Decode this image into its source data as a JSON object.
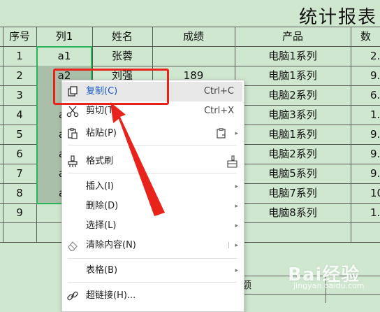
{
  "sheet": {
    "title": "统计报表",
    "headers": [
      "序号",
      "列1",
      "姓名",
      "成绩",
      "产品",
      "数"
    ],
    "rows": [
      {
        "num": "1",
        "col1": "a1",
        "name": "张蓉",
        "score": "",
        "product": "电脑1系列",
        "qty": "2."
      },
      {
        "num": "2",
        "col1": "a2",
        "name": "刘强",
        "score": "189",
        "product": "电脑1系列",
        "qty": "9."
      },
      {
        "num": "3",
        "col1": "",
        "name": "",
        "score": "",
        "product": "电脑2系列",
        "qty": "6."
      },
      {
        "num": "4",
        "col1": "a",
        "name": "",
        "score": "",
        "product": "电脑3系列",
        "qty": "1."
      },
      {
        "num": "5",
        "col1": "a",
        "name": "",
        "score": "",
        "product": "电脑1系列",
        "qty": "9."
      },
      {
        "num": "6",
        "col1": "a",
        "name": "",
        "score": "",
        "product": "电脑2系列",
        "qty": "9."
      },
      {
        "num": "7",
        "col1": "a",
        "name": "",
        "score": "",
        "product": "电脑5系列",
        "qty": "9."
      },
      {
        "num": "8",
        "col1": "a",
        "name": "",
        "score": "",
        "product": "电脑7系列",
        "qty": "10"
      },
      {
        "num": "9",
        "col1": "",
        "name": "",
        "score": "",
        "product": "电脑8系列",
        "qty": "1."
      }
    ],
    "footer_label": "金额"
  },
  "menu": {
    "copy": {
      "label": "复制(C)",
      "shortcut": "Ctrl+C"
    },
    "cut": {
      "label": "剪切(T)",
      "shortcut": "Ctrl+X"
    },
    "paste": {
      "label": "粘贴(P)"
    },
    "format_painter": {
      "label": "格式刷"
    },
    "insert": {
      "label": "插入(I)"
    },
    "delete": {
      "label": "删除(D)"
    },
    "select": {
      "label": "选择(L)"
    },
    "clear": {
      "label": "清除内容(N)"
    },
    "table": {
      "label": "表格(B)"
    },
    "hyperlink": {
      "label": "超链接(H)..."
    }
  },
  "watermark": {
    "text": "Bai经验",
    "url": "jingyan.baidu.com"
  },
  "colors": {
    "accent_red": "#e8231b",
    "selection_green": "#2bb35a",
    "sheet_bg": "#cfe6cf"
  }
}
